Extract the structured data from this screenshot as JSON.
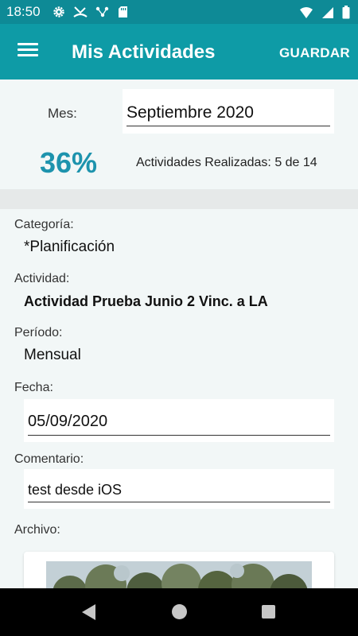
{
  "status_bar": {
    "time": "18:50",
    "icons": [
      "gear-icon",
      "missed-call-icon",
      "connection-icon",
      "sd-card-icon",
      "wifi-icon",
      "signal-icon",
      "battery-icon"
    ]
  },
  "app_bar": {
    "title": "Mis Actividades",
    "save_label": "GUARDAR",
    "menu_icon": "hamburger-menu-icon"
  },
  "summary": {
    "month_label": "Mes:",
    "month_value": "Septiembre 2020",
    "percent": "36%",
    "completed_text": "Actividades Realizadas: 5 de 14"
  },
  "detail": {
    "category_label": "Categoría:",
    "category_value": "*Planificación",
    "activity_label": "Actividad:",
    "activity_value": "Actividad Prueba Junio 2 Vinc. a LA",
    "period_label": "Período:",
    "period_value": "Mensual",
    "date_label": "Fecha:",
    "date_value": "05/09/2020",
    "comment_label": "Comentario:",
    "comment_value": "test desde iOS",
    "file_label": "Archivo:"
  },
  "colors": {
    "appbar": "#0e9ba6",
    "statusbar": "#0e8a96",
    "percent": "#1d93ad",
    "background": "#f2f7f7"
  },
  "nav_bar": {
    "icons": [
      "back-icon",
      "home-icon",
      "recent-apps-icon"
    ]
  }
}
